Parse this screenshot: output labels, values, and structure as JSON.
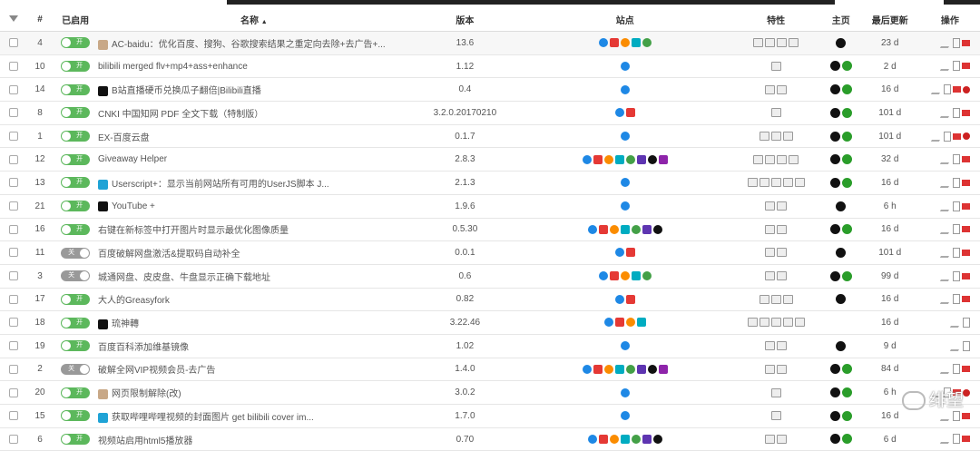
{
  "headers": {
    "filter": "",
    "idx": "#",
    "enabled": "已启用",
    "name": "名称",
    "version": "版本",
    "site": "站点",
    "feature": "特性",
    "home": "主页",
    "updated": "最后更新",
    "action": "操作"
  },
  "toggle_on": "开",
  "toggle_off": "关",
  "watermark": "绯望",
  "rows": [
    {
      "idx": "4",
      "on": true,
      "name": "AC-baidu：优化百度、搜狗、谷歌搜索结果之重定向去除+去广告+...",
      "ver": "13.6",
      "sites": 5,
      "feat": 4,
      "home": 1,
      "days": "23 d",
      "acts": 3
    },
    {
      "idx": "10",
      "on": true,
      "name": "bilibili merged flv+mp4+ass+enhance",
      "ver": "1.12",
      "sites": 1,
      "feat": 1,
      "home": 2,
      "days": "2 d",
      "acts": 3
    },
    {
      "idx": "14",
      "on": true,
      "name": "B站直播硬币兑换瓜子翻倍|Bilibili直播",
      "ver": "0.4",
      "sites": 1,
      "feat": 2,
      "home": 2,
      "days": "16 d",
      "acts": 4
    },
    {
      "idx": "8",
      "on": true,
      "name": "CNKI 中国知网 PDF 全文下载（特制版）",
      "ver": "3.2.0.20170210",
      "sites": 2,
      "feat": 1,
      "home": 2,
      "days": "101 d",
      "acts": 3
    },
    {
      "idx": "1",
      "on": true,
      "name": "EX-百度云盘",
      "ver": "0.1.7",
      "sites": 1,
      "feat": 3,
      "home": 2,
      "days": "101 d",
      "acts": 4
    },
    {
      "idx": "12",
      "on": true,
      "name": "Giveaway Helper",
      "ver": "2.8.3",
      "sites": 8,
      "feat": 4,
      "home": 2,
      "days": "32 d",
      "acts": 3
    },
    {
      "idx": "13",
      "on": true,
      "name": "Userscript+：显示当前网站所有可用的UserJS脚本 J...",
      "ver": "2.1.3",
      "sites": 1,
      "feat": 5,
      "home": 2,
      "days": "16 d",
      "acts": 3
    },
    {
      "idx": "21",
      "on": true,
      "name": "YouTube +",
      "ver": "1.9.6",
      "sites": 1,
      "feat": 2,
      "home": 1,
      "days": "6 h",
      "acts": 3
    },
    {
      "idx": "16",
      "on": true,
      "name": "右键在新标签中打开图片时显示最优化图像质量",
      "ver": "0.5.30",
      "sites": 7,
      "feat": 2,
      "home": 2,
      "days": "16 d",
      "acts": 3
    },
    {
      "idx": "11",
      "on": false,
      "name": "百度破解网盘激活&提取码自动补全",
      "ver": "0.0.1",
      "sites": 2,
      "feat": 2,
      "home": 1,
      "days": "101 d",
      "acts": 3
    },
    {
      "idx": "3",
      "on": false,
      "name": "城通网盘、皮皮盘、牛盘显示正确下载地址",
      "ver": "0.6",
      "sites": 5,
      "feat": 2,
      "home": 2,
      "days": "99 d",
      "acts": 3
    },
    {
      "idx": "17",
      "on": true,
      "name": "大人的Greasyfork",
      "ver": "0.82",
      "sites": 2,
      "feat": 3,
      "home": 1,
      "days": "16 d",
      "acts": 3
    },
    {
      "idx": "18",
      "on": true,
      "name": "琉神轉",
      "ver": "3.22.46",
      "sites": 4,
      "feat": 5,
      "home": 0,
      "days": "16 d",
      "acts": 2
    },
    {
      "idx": "19",
      "on": true,
      "name": "百度百科添加维基镜像",
      "ver": "1.02",
      "sites": 1,
      "feat": 2,
      "home": 1,
      "days": "9 d",
      "acts": 2
    },
    {
      "idx": "2",
      "on": false,
      "name": "破解全网VIP视频会员-去广告",
      "ver": "1.4.0",
      "sites": 8,
      "feat": 2,
      "home": 2,
      "days": "84 d",
      "acts": 3
    },
    {
      "idx": "20",
      "on": true,
      "name": "网页限制解除(改)",
      "ver": "3.0.2",
      "sites": 1,
      "feat": 1,
      "home": 2,
      "days": "6 h",
      "acts": 4
    },
    {
      "idx": "15",
      "on": true,
      "name": "获取哔哩哔哩视频的封面图片 get bilibili cover im...",
      "ver": "1.7.0",
      "sites": 1,
      "feat": 1,
      "home": 2,
      "days": "16 d",
      "acts": 3
    },
    {
      "idx": "6",
      "on": true,
      "name": "视频站启用html5播放器",
      "ver": "0.70",
      "sites": 7,
      "feat": 2,
      "home": 2,
      "days": "6 d",
      "acts": 3
    }
  ]
}
